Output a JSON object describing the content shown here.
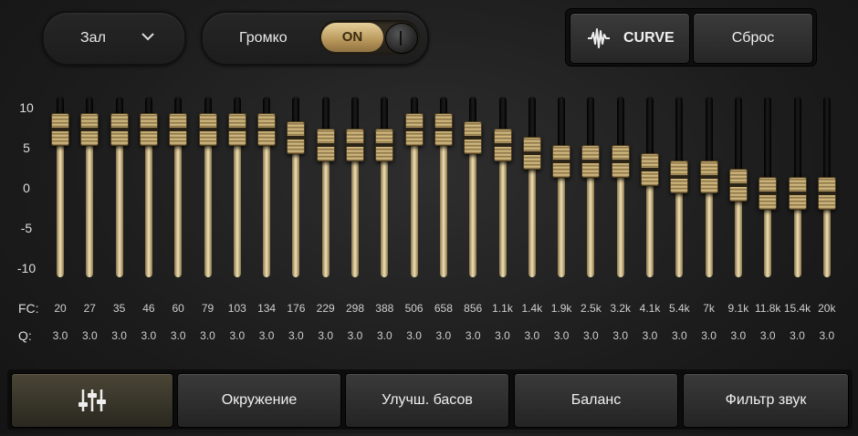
{
  "header": {
    "preset": {
      "label": "Зал",
      "icon": "chevron-down-icon"
    },
    "loudness": {
      "label": "Громко",
      "toggle_label": "ON",
      "state": "on"
    },
    "curve_button": {
      "label": "CURVE",
      "icon": "waveform-icon"
    },
    "reset_button": {
      "label": "Сброс"
    }
  },
  "equalizer": {
    "y_ticks": [
      "10",
      "5",
      "0",
      "-5",
      "-10"
    ],
    "range": [
      -10,
      10
    ],
    "fc_label": "FC:",
    "q_label": "Q:",
    "bands": [
      {
        "fc": "20",
        "q": "3.0",
        "gain": 7.5
      },
      {
        "fc": "27",
        "q": "3.0",
        "gain": 7.5
      },
      {
        "fc": "35",
        "q": "3.0",
        "gain": 7.5
      },
      {
        "fc": "46",
        "q": "3.0",
        "gain": 7.5
      },
      {
        "fc": "60",
        "q": "3.0",
        "gain": 7.5
      },
      {
        "fc": "79",
        "q": "3.0",
        "gain": 7.5
      },
      {
        "fc": "103",
        "q": "3.0",
        "gain": 7.5
      },
      {
        "fc": "134",
        "q": "3.0",
        "gain": 7.5
      },
      {
        "fc": "176",
        "q": "3.0",
        "gain": 6.5
      },
      {
        "fc": "229",
        "q": "3.0",
        "gain": 5.5
      },
      {
        "fc": "298",
        "q": "3.0",
        "gain": 5.5
      },
      {
        "fc": "388",
        "q": "3.0",
        "gain": 5.5
      },
      {
        "fc": "506",
        "q": "3.0",
        "gain": 7.5
      },
      {
        "fc": "658",
        "q": "3.0",
        "gain": 7.5
      },
      {
        "fc": "856",
        "q": "3.0",
        "gain": 6.5
      },
      {
        "fc": "1.1k",
        "q": "3.0",
        "gain": 5.5
      },
      {
        "fc": "1.4k",
        "q": "3.0",
        "gain": 4.5
      },
      {
        "fc": "1.9k",
        "q": "3.0",
        "gain": 3.5
      },
      {
        "fc": "2.5k",
        "q": "3.0",
        "gain": 3.5
      },
      {
        "fc": "3.2k",
        "q": "3.0",
        "gain": 3.5
      },
      {
        "fc": "4.1k",
        "q": "3.0",
        "gain": 2.5
      },
      {
        "fc": "5.4k",
        "q": "3.0",
        "gain": 1.5
      },
      {
        "fc": "7k",
        "q": "3.0",
        "gain": 1.5
      },
      {
        "fc": "9.1k",
        "q": "3.0",
        "gain": 0.5
      },
      {
        "fc": "11.8k",
        "q": "3.0",
        "gain": -0.5
      },
      {
        "fc": "15.4k",
        "q": "3.0",
        "gain": -0.5
      },
      {
        "fc": "20k",
        "q": "3.0",
        "gain": -0.5
      }
    ]
  },
  "tabs": [
    {
      "label": "",
      "icon": "equalizer-sliders-icon",
      "active": true
    },
    {
      "label": "Окружение"
    },
    {
      "label": "Улучш. басов"
    },
    {
      "label": "Баланс"
    },
    {
      "label": "Фильтр звук"
    }
  ],
  "colors": {
    "accent_gold": "#d9c38d",
    "background": "#1c1c1c"
  }
}
